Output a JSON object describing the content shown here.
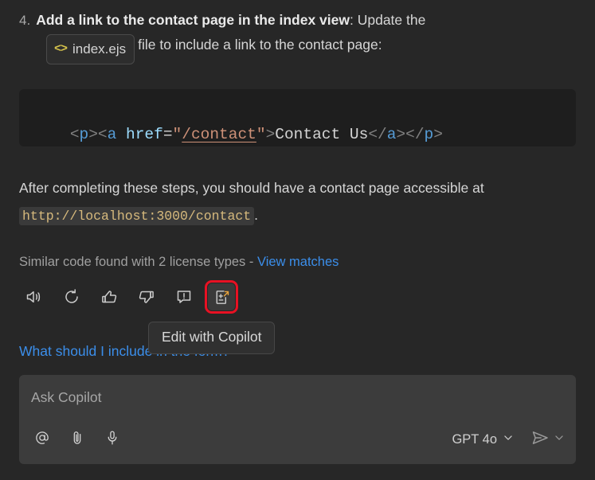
{
  "step": {
    "number": "4.",
    "bold_text": "Add a link to the contact page in the index view",
    "after_bold": ": Update the",
    "file_chip": {
      "icon": "code-brackets-icon",
      "label": "index.ejs"
    },
    "tail_text": "file to include a link to the contact page:"
  },
  "code_block": {
    "language": "html",
    "tokens": [
      {
        "text": "<",
        "type": "punct"
      },
      {
        "text": "p",
        "type": "tag"
      },
      {
        "text": "><",
        "type": "punct"
      },
      {
        "text": "a",
        "type": "tag"
      },
      {
        "text": " ",
        "type": "text"
      },
      {
        "text": "href",
        "type": "attr"
      },
      {
        "text": "=",
        "type": "eq"
      },
      {
        "text": "\"",
        "type": "str"
      },
      {
        "text": "/contact",
        "type": "link"
      },
      {
        "text": "\"",
        "type": "str"
      },
      {
        "text": ">",
        "type": "punct"
      },
      {
        "text": "Contact Us",
        "type": "text"
      },
      {
        "text": "</",
        "type": "punct"
      },
      {
        "text": "a",
        "type": "tag"
      },
      {
        "text": "></",
        "type": "punct"
      },
      {
        "text": "p",
        "type": "tag"
      },
      {
        "text": ">",
        "type": "punct"
      }
    ],
    "plain": "<p><a href=\"/contact\">Contact Us</a></p>"
  },
  "paragraph": {
    "before_code": "After completing these steps, you should have a contact page accessible at ",
    "code": "http://localhost:3000/contact",
    "after_code": "."
  },
  "license": {
    "text": "Similar code found with 2 license types - ",
    "link_label": "View matches"
  },
  "toolbar": {
    "buttons": [
      {
        "name": "read-aloud-button",
        "icon": "speaker-icon",
        "label": "Read aloud",
        "active": false
      },
      {
        "name": "retry-button",
        "icon": "refresh-icon",
        "label": "Retry",
        "active": false
      },
      {
        "name": "thumbs-up-button",
        "icon": "thumbs-up-icon",
        "label": "Helpful",
        "active": false
      },
      {
        "name": "thumbs-down-button",
        "icon": "thumbs-down-icon",
        "label": "Unhelpful",
        "active": false
      },
      {
        "name": "report-button",
        "icon": "report-icon",
        "label": "Report",
        "active": false
      },
      {
        "name": "edit-with-copilot-button",
        "icon": "edit-with-copilot-icon",
        "label": "Edit with Copilot",
        "active": true
      }
    ],
    "highlight_color": "#e81123"
  },
  "tooltip": {
    "text": "Edit with Copilot"
  },
  "suggestion": {
    "text": "What should I include in the form?",
    "color": "#3b8eea"
  },
  "input": {
    "placeholder": "Ask Copilot",
    "value": "",
    "left_buttons": [
      {
        "name": "mention-button",
        "icon": "at-sign-icon",
        "glyph": "@"
      },
      {
        "name": "attach-button",
        "icon": "paperclip-icon"
      },
      {
        "name": "voice-button",
        "icon": "microphone-icon"
      }
    ],
    "model": {
      "label": "GPT 4o",
      "chevron": "chevron-down-icon"
    },
    "send": {
      "icon": "send-icon",
      "chevron": "chevron-down-icon"
    }
  },
  "theme": {
    "background": "#272727",
    "code_background": "#1e1e1e",
    "input_background": "#3c3c3c",
    "link": "#3b8eea",
    "text": "#d6d6d6"
  }
}
